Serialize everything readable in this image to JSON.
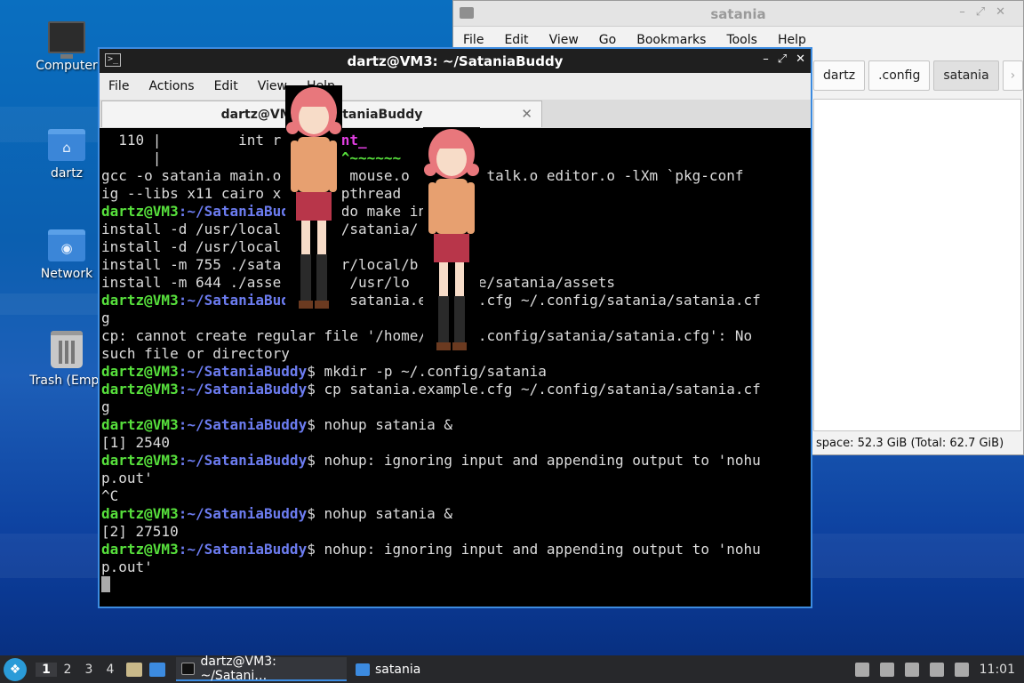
{
  "desktop": {
    "icons": [
      {
        "label": "Computer",
        "icon": "computer-icon"
      },
      {
        "label": "dartz",
        "icon": "home-folder-icon"
      },
      {
        "label": "Network",
        "icon": "network-folder-icon"
      },
      {
        "label": "Trash (Empt",
        "icon": "trash-icon"
      }
    ]
  },
  "file_manager": {
    "title": "satania",
    "menu": [
      "File",
      "Edit",
      "View",
      "Go",
      "Bookmarks",
      "Tools",
      "Help"
    ],
    "breadcrumbs": [
      "dartz",
      ".config",
      "satania"
    ],
    "status": "space: 52.3 GiB (Total: 62.7 GiB)"
  },
  "terminal": {
    "title": "dartz@VM3: ~/SataniaBuddy",
    "menu": [
      "File",
      "Actions",
      "Edit",
      "View",
      "Help"
    ],
    "tab_label": "dartz@VM3: ~/SataniaBuddy",
    "prompt_user": "dartz@VM3",
    "prompt_path": ":~/SataniaBuddy",
    "lines": [
      {
        "kind": "err",
        "text": "  110 |         int r = ",
        "hl": "client_",
        "tail": ""
      },
      {
        "kind": "err2",
        "text": "      |                     ",
        "hl": "^~~~~~~"
      },
      {
        "kind": "out",
        "text": "gcc -o satania main.o      o mouse.o    te.o talk.o editor.o -lXm `pkg-conf"
      },
      {
        "kind": "out",
        "text": "ig --libs x11 cairo x      -pthread"
      },
      {
        "kind": "cmd",
        "text": "$ sudo make install"
      },
      {
        "kind": "out",
        "text": "install -d /usr/local       /satania/"
      },
      {
        "kind": "out",
        "text": "install -d /usr/local"
      },
      {
        "kind": "out",
        "text": "install -m 755 ./sata      sr/local/b"
      },
      {
        "kind": "out",
        "text": "install -m 644 ./asse     ng /usr/lo     hare/satania/assets"
      },
      {
        "kind": "cmd",
        "text": "$ cp satania.example.cfg ~/.config/satania/satania.cf"
      },
      {
        "kind": "out",
        "text": "g"
      },
      {
        "kind": "out",
        "text": "cp: cannot create regular file '/home/dartz/.config/satania/satania.cfg': No"
      },
      {
        "kind": "out",
        "text": "such file or directory"
      },
      {
        "kind": "cmd",
        "text": "$ mkdir -p ~/.config/satania"
      },
      {
        "kind": "cmd",
        "text": "$ cp satania.example.cfg ~/.config/satania/satania.cf"
      },
      {
        "kind": "out",
        "text": "g"
      },
      {
        "kind": "cmd",
        "text": "$ nohup satania &"
      },
      {
        "kind": "out",
        "text": "[1] 2540"
      },
      {
        "kind": "cmd",
        "text": "$ nohup: ignoring input and appending output to 'nohu"
      },
      {
        "kind": "out",
        "text": "p.out'"
      },
      {
        "kind": "out",
        "text": "^C"
      },
      {
        "kind": "cmd",
        "text": "$ nohup satania &"
      },
      {
        "kind": "out",
        "text": "[2] 27510"
      },
      {
        "kind": "cmd",
        "text": "$ nohup: ignoring input and appending output to 'nohu"
      },
      {
        "kind": "out",
        "text": "p.out'"
      },
      {
        "kind": "cursor",
        "text": ""
      }
    ]
  },
  "taskbar": {
    "workspaces": [
      "1",
      "2",
      "3",
      "4"
    ],
    "tasks": [
      {
        "label": "dartz@VM3: ~/Satani…",
        "icon": "terminal-icon"
      },
      {
        "label": "satania",
        "icon": "folder-icon"
      }
    ],
    "clock": "11:01"
  },
  "colors": {
    "accent": "#3c8be0",
    "prompt_user": "#57e03c",
    "prompt_path": "#6c7cf0"
  }
}
